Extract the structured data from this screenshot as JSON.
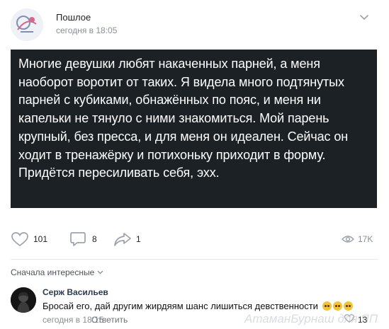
{
  "post": {
    "author": "Пошлое",
    "time": "сегодня в 18:05",
    "text": "Многие девушки любят накаченных парней, а меня наоборот воротит от таких. Я видела много подтянутых парней с кубиками, обнажённых по пояс, и меня ни капельки не тянуло с ними знакомиться. Мой парень крупный, без пресса, и для меня он идеален. Сейчас он ходит в тренажёрку и потихоньку приходит в форму. Придётся пересиливать себя, эхх."
  },
  "actions": {
    "likes": "101",
    "comments": "8",
    "shares": "1",
    "views": "17K"
  },
  "comments_section": {
    "sort_label": "Сначала интересные"
  },
  "comment": {
    "author": "Серж Васильев",
    "text": "Бросай его, дай другим жирдяям шанс лишиться девственности",
    "time": "сегодня в 18:15",
    "reply_label": "Ответить",
    "likes": "13"
  },
  "watermark": "АтаманБурнаш для ЯП",
  "icons": {
    "post_menu": "chevron-down-icon",
    "like": "heart-icon",
    "comment": "comment-bubble-icon",
    "share": "share-arrow-icon",
    "views": "eye-icon",
    "sort": "chevron-down-icon",
    "comment_like": "heart-icon"
  },
  "colors": {
    "text_card_bg": "#1c2126",
    "secondary_text": "#8a8f96",
    "icon": "#99a2ad"
  }
}
